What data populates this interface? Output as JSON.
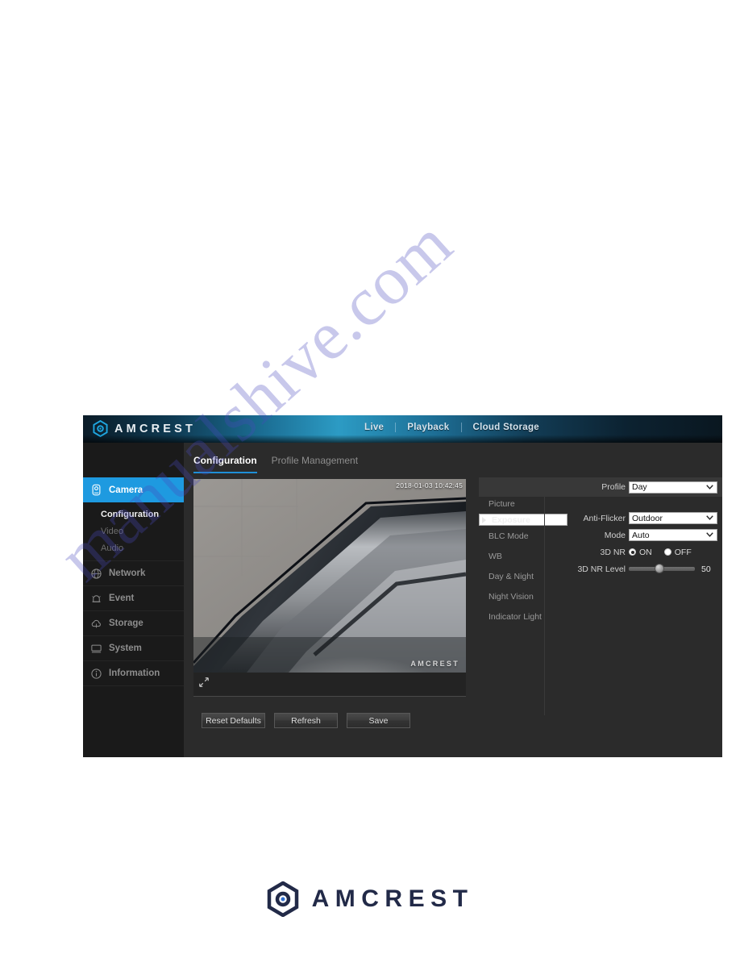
{
  "page": {
    "watermark": "manualshive.com"
  },
  "header": {
    "brand": "AMCREST",
    "brand_icon": "amcrest-hexagon-logo",
    "nav": [
      {
        "label": "Live"
      },
      {
        "label": "Playback"
      },
      {
        "label": "Cloud Storage"
      }
    ]
  },
  "sidebar": {
    "items": [
      {
        "label": "Camera",
        "icon": "camera-icon",
        "active": true
      },
      {
        "label": "Network",
        "icon": "network-globe-icon",
        "active": false
      },
      {
        "label": "Event",
        "icon": "event-bell-icon",
        "active": false
      },
      {
        "label": "Storage",
        "icon": "storage-cloud-icon",
        "active": false
      },
      {
        "label": "System",
        "icon": "system-monitor-icon",
        "active": false
      },
      {
        "label": "Information",
        "icon": "information-icon",
        "active": false
      }
    ],
    "camera_subitems": [
      {
        "label": "Configuration",
        "current": true
      },
      {
        "label": "Video",
        "current": false
      },
      {
        "label": "Audio",
        "current": false
      }
    ]
  },
  "tabs": [
    {
      "label": "Configuration",
      "active": true
    },
    {
      "label": "Profile Management",
      "active": false
    }
  ],
  "video": {
    "timestamp": "2018-01-03 10:42:45",
    "overlay_brand": "AMCREST",
    "expand_icon": "expand-fullscreen-icon"
  },
  "settings_menu": [
    {
      "label": "Picture",
      "selected": false
    },
    {
      "label": "Exposure",
      "selected": true
    },
    {
      "label": "BLC Mode",
      "selected": false
    },
    {
      "label": "WB",
      "selected": false
    },
    {
      "label": "Day & Night",
      "selected": false
    },
    {
      "label": "Night Vision",
      "selected": false
    },
    {
      "label": "Indicator Light",
      "selected": false
    }
  ],
  "form": {
    "profile": {
      "label": "Profile",
      "value": "Day"
    },
    "anti_flicker": {
      "label": "Anti-Flicker",
      "value": "Outdoor"
    },
    "mode": {
      "label": "Mode",
      "value": "Auto"
    },
    "nr_3d": {
      "label": "3D NR",
      "on_label": "ON",
      "off_label": "OFF",
      "selected": "ON"
    },
    "nr_3d_level": {
      "label": "3D NR Level",
      "value": "50"
    }
  },
  "buttons": [
    {
      "label": "Reset Defaults"
    },
    {
      "label": "Refresh"
    },
    {
      "label": "Save"
    }
  ],
  "footer": {
    "brand": "AMCREST",
    "logo_icon": "amcrest-hexagon-logo"
  },
  "colors": {
    "accent_blue": "#1e9ae0",
    "tab_underline": "#1e8fd6",
    "panel_bg": "#2b2b2b",
    "sidebar_bg": "#1a1a1a",
    "footer_navy": "#222a48"
  }
}
